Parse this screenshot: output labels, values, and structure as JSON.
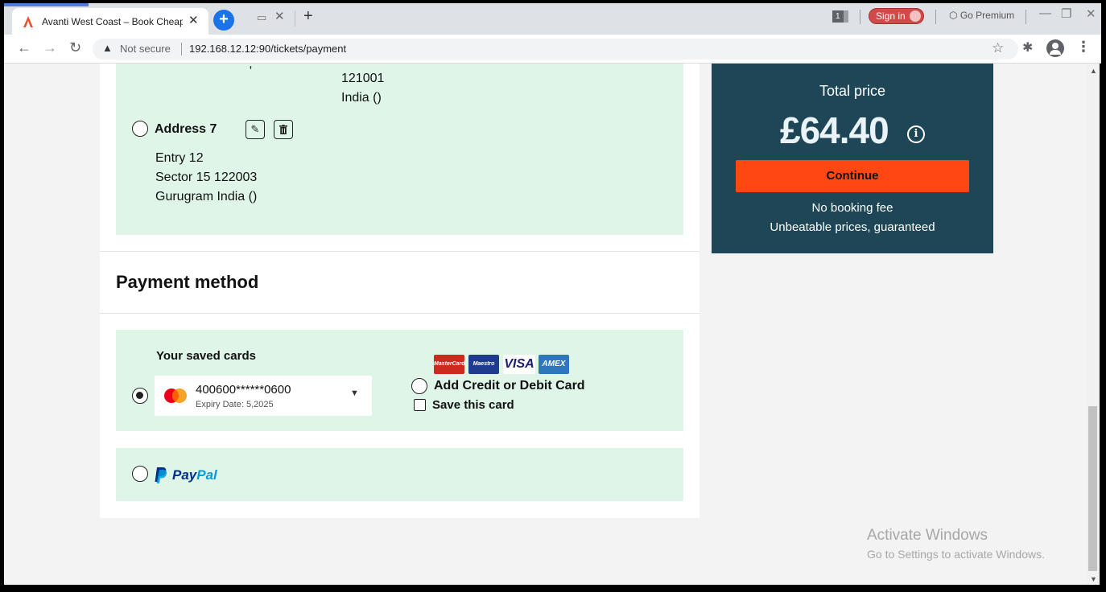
{
  "browser": {
    "tab_title": "Avanti West Coast – Book Cheap",
    "tab_close": "✕",
    "new_tab_button": "+",
    "tab_count": "1",
    "sign_in_label": "Sign in",
    "go_premium_label": "Go Premium",
    "security_label": "Not secure",
    "url": "192.168.12.12:90/tickets/payment"
  },
  "addresses": {
    "previous": {
      "cut_line": "\"                                            ,                                   \"",
      "postcode": "121001",
      "country": "India ()"
    },
    "address7": {
      "title": "Address 7",
      "line1": "Entry 12",
      "line2": "Sector 15 122003",
      "line3": "Gurugram India ()"
    }
  },
  "payment": {
    "heading": "Payment method",
    "saved_cards_title": "Your saved cards",
    "card_number": "400600******0600",
    "card_expiry": "Expiry Date: 5,2025",
    "card_logos": [
      "MasterCard",
      "Maestro",
      "VISA",
      "AMEX"
    ],
    "add_card_label": "Add Credit or Debit Card",
    "save_card_label": "Save this card",
    "paypal_pay": "Pay",
    "paypal_pal": "Pal"
  },
  "summary": {
    "total_label": "Total price",
    "total_price": "£64.40",
    "info_glyph": "i",
    "continue_label": "Continue",
    "fee_text": "No booking fee",
    "price_promise": "Unbeatable prices, guaranteed"
  },
  "windows": {
    "activate_title": "Activate Windows",
    "activate_sub": "Go to Settings to activate Windows."
  },
  "colors": {
    "accent_orange": "#ff4713",
    "summary_bg": "#1e4656",
    "option_bg": "#dff5e8"
  }
}
